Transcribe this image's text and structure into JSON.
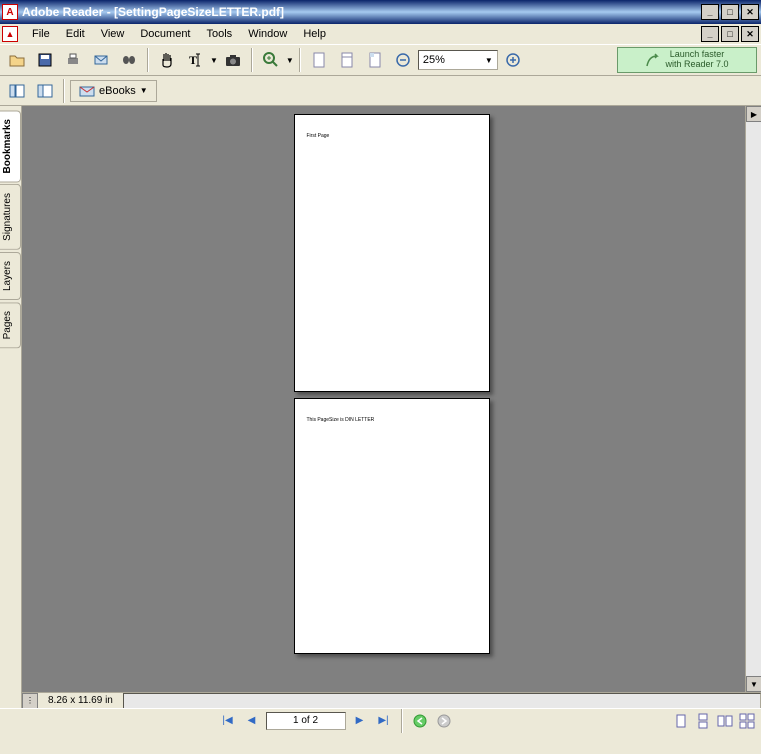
{
  "titlebar": {
    "app_name": "Adobe Reader",
    "doc_name": "[SettingPageSizeLETTER.pdf]"
  },
  "menu": {
    "file": "File",
    "edit": "Edit",
    "view": "View",
    "document": "Document",
    "tools": "Tools",
    "window": "Window",
    "help": "Help"
  },
  "toolbar": {
    "zoom_value": "25%",
    "promo_line1": "Launch faster",
    "promo_line2": "with Reader 7.0",
    "ebooks_label": "eBooks"
  },
  "side_tabs": {
    "bookmarks": "Bookmarks",
    "signatures": "Signatures",
    "layers": "Layers",
    "pages": "Pages"
  },
  "pages": {
    "page1_text": "First Page",
    "page2_text": "This PageSize is DIN LETTER"
  },
  "status": {
    "page_size": "8.26 x 11.69 in",
    "page_nav": "1 of 2"
  }
}
